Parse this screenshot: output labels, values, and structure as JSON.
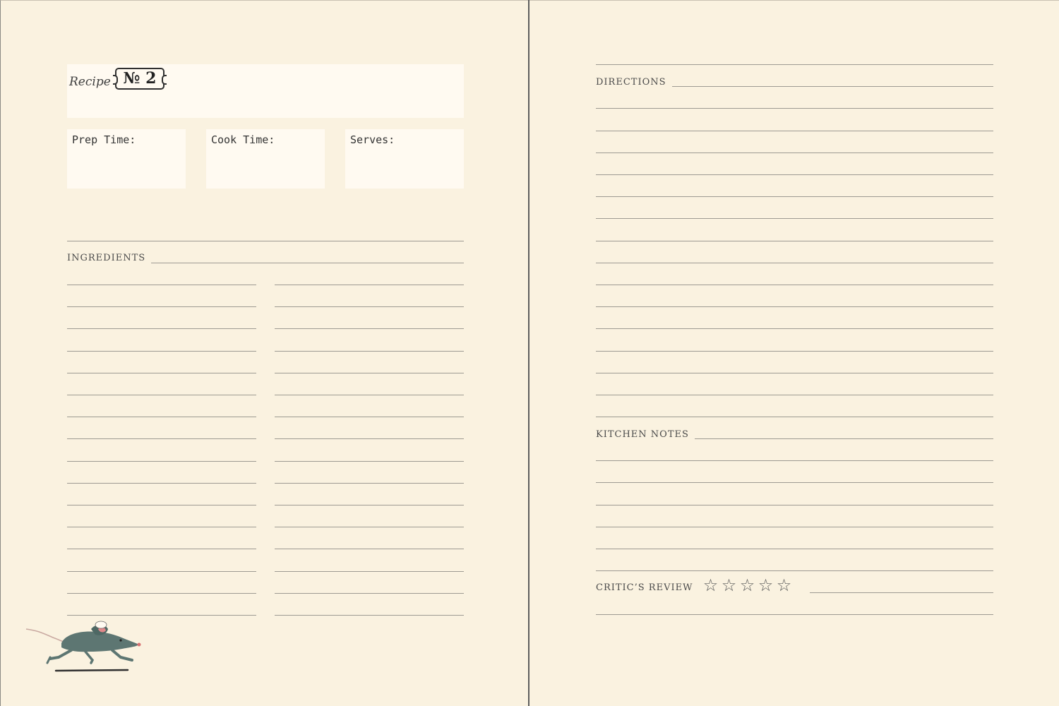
{
  "recipe_card": {
    "recipe_label": "Recipe",
    "number_badge": "№ 2",
    "prep_time_label": "Prep Time:",
    "cook_time_label": "Cook Time:",
    "serves_label": "Serves:"
  },
  "sections": {
    "ingredients_label": "INGREDIENTS",
    "directions_label": "DIRECTIONS",
    "kitchen_notes_label": "KITCHEN NOTES",
    "critics_review_label": "CRITIC’S REVIEW"
  },
  "rating": {
    "stars": [
      "☆",
      "☆",
      "☆",
      "☆",
      "☆"
    ],
    "filled": 0,
    "max": 5
  },
  "colors": {
    "paper": "#faf2e0",
    "field": "#fffaf1",
    "rule": "#9d9a92",
    "rat_body": "#5d7672",
    "rat_ear": "#e0888a"
  },
  "icons": {
    "illustration": "chef-rat-icon"
  }
}
